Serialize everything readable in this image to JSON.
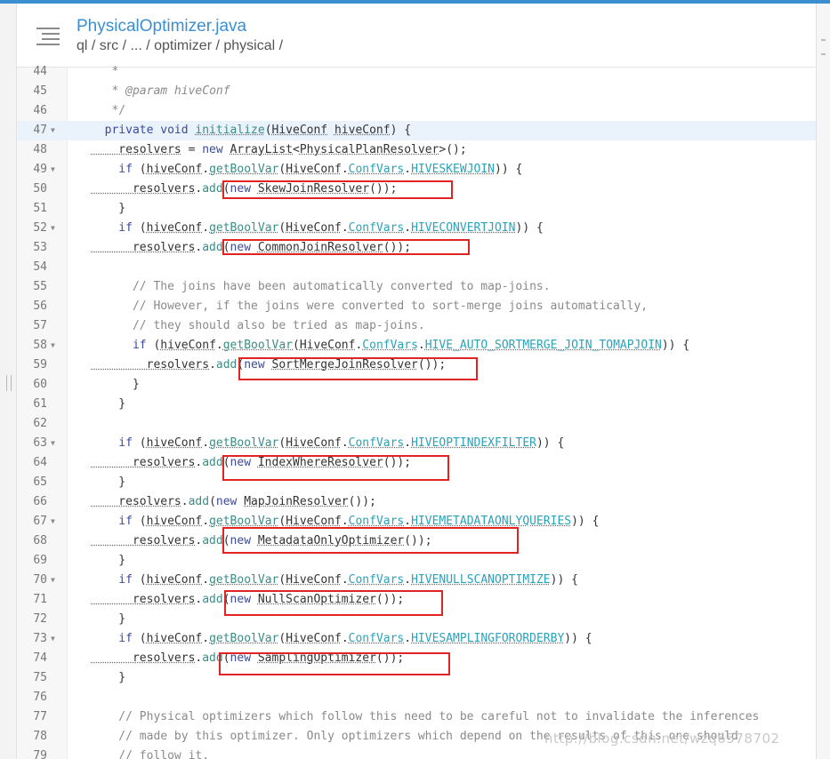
{
  "header": {
    "file_title": "PhysicalOptimizer.java",
    "breadcrumb": "ql / src / ... / optimizer / physical /"
  },
  "icons": {
    "menu": "hamburger-menu-icon",
    "fold": "fold-arrow-icon"
  },
  "colors": {
    "accent": "#3b8fd1",
    "highlight_box": "#e02424",
    "active_line": "#eaf2fb"
  },
  "editor": {
    "active_line": 47,
    "lines": [
      {
        "n": "44",
        "fold": false,
        "parts": [
          [
            "c",
            "   *"
          ]
        ]
      },
      {
        "n": "45",
        "fold": false,
        "parts": [
          [
            "c",
            "   * "
          ],
          [
            "ci",
            "@param"
          ],
          [
            "ci",
            " hiveConf"
          ]
        ]
      },
      {
        "n": "46",
        "fold": false,
        "parts": [
          [
            "c",
            "   */"
          ]
        ]
      },
      {
        "n": "47",
        "fold": true,
        "parts": [
          [
            "k",
            "  private void "
          ],
          [
            "mu",
            "initialize"
          ],
          [
            "t",
            "("
          ],
          [
            "tu",
            "HiveConf"
          ],
          [
            "t",
            " "
          ],
          [
            "tu",
            "hiveConf"
          ],
          [
            "t",
            ") {"
          ]
        ]
      },
      {
        "n": "48",
        "fold": false,
        "parts": [
          [
            "tu",
            "    resolvers"
          ],
          [
            "t",
            " = "
          ],
          [
            "k",
            "new "
          ],
          [
            "tu",
            "ArrayList"
          ],
          [
            "t",
            "<"
          ],
          [
            "tu",
            "PhysicalPlanResolver"
          ],
          [
            "t",
            ">();"
          ]
        ]
      },
      {
        "n": "49",
        "fold": true,
        "parts": [
          [
            "k",
            "    if "
          ],
          [
            "t",
            "("
          ],
          [
            "tu",
            "hiveConf"
          ],
          [
            "t",
            "."
          ],
          [
            "mu",
            "getBoolVar"
          ],
          [
            "t",
            "("
          ],
          [
            "tu",
            "HiveConf"
          ],
          [
            "t",
            "."
          ],
          [
            "su",
            "ConfVars"
          ],
          [
            "t",
            "."
          ],
          [
            "su",
            "HIVESKEWJOIN"
          ],
          [
            "t",
            ")) {"
          ]
        ]
      },
      {
        "n": "50",
        "fold": false,
        "parts": [
          [
            "tu",
            "      resolvers"
          ],
          [
            "t",
            "."
          ],
          [
            "m",
            "add"
          ],
          [
            "t",
            "("
          ],
          [
            "k",
            "new "
          ],
          [
            "tu",
            "SkewJoinResolver"
          ],
          [
            "t",
            "());"
          ]
        ]
      },
      {
        "n": "51",
        "fold": false,
        "parts": [
          [
            "t",
            "    }"
          ]
        ]
      },
      {
        "n": "52",
        "fold": true,
        "parts": [
          [
            "k",
            "    if "
          ],
          [
            "t",
            "("
          ],
          [
            "tu",
            "hiveConf"
          ],
          [
            "t",
            "."
          ],
          [
            "mu",
            "getBoolVar"
          ],
          [
            "t",
            "("
          ],
          [
            "tu",
            "HiveConf"
          ],
          [
            "t",
            "."
          ],
          [
            "su",
            "ConfVars"
          ],
          [
            "t",
            "."
          ],
          [
            "su",
            "HIVECONVERTJOIN"
          ],
          [
            "t",
            ")) {"
          ]
        ]
      },
      {
        "n": "53",
        "fold": false,
        "parts": [
          [
            "tu",
            "      resolvers"
          ],
          [
            "t",
            "."
          ],
          [
            "m",
            "add"
          ],
          [
            "t",
            "("
          ],
          [
            "k",
            "new "
          ],
          [
            "tu",
            "CommonJoinResolver"
          ],
          [
            "t",
            "());"
          ]
        ]
      },
      {
        "n": "54",
        "fold": false,
        "parts": [
          [
            "t",
            ""
          ]
        ]
      },
      {
        "n": "55",
        "fold": false,
        "parts": [
          [
            "c",
            "      // The joins have been automatically converted to map-joins."
          ]
        ]
      },
      {
        "n": "56",
        "fold": false,
        "parts": [
          [
            "c",
            "      // However, if the joins were converted to sort-merge joins automatically,"
          ]
        ]
      },
      {
        "n": "57",
        "fold": false,
        "parts": [
          [
            "c",
            "      // they should also be tried as map-joins."
          ]
        ]
      },
      {
        "n": "58",
        "fold": true,
        "parts": [
          [
            "k",
            "      if "
          ],
          [
            "t",
            "("
          ],
          [
            "tu",
            "hiveConf"
          ],
          [
            "t",
            "."
          ],
          [
            "mu",
            "getBoolVar"
          ],
          [
            "t",
            "("
          ],
          [
            "tu",
            "HiveConf"
          ],
          [
            "t",
            "."
          ],
          [
            "su",
            "ConfVars"
          ],
          [
            "t",
            "."
          ],
          [
            "su",
            "HIVE_AUTO_SORTMERGE_JOIN_TOMAPJOIN"
          ],
          [
            "t",
            ")) {"
          ]
        ]
      },
      {
        "n": "59",
        "fold": false,
        "parts": [
          [
            "tu",
            "        resolvers"
          ],
          [
            "t",
            "."
          ],
          [
            "m",
            "add"
          ],
          [
            "t",
            "("
          ],
          [
            "k",
            "new "
          ],
          [
            "tu",
            "SortMergeJoinResolver"
          ],
          [
            "t",
            "());"
          ]
        ]
      },
      {
        "n": "60",
        "fold": false,
        "parts": [
          [
            "t",
            "      }"
          ]
        ]
      },
      {
        "n": "61",
        "fold": false,
        "parts": [
          [
            "t",
            "    }"
          ]
        ]
      },
      {
        "n": "62",
        "fold": false,
        "parts": [
          [
            "t",
            ""
          ]
        ]
      },
      {
        "n": "63",
        "fold": true,
        "parts": [
          [
            "k",
            "    if "
          ],
          [
            "t",
            "("
          ],
          [
            "tu",
            "hiveConf"
          ],
          [
            "t",
            "."
          ],
          [
            "mu",
            "getBoolVar"
          ],
          [
            "t",
            "("
          ],
          [
            "tu",
            "HiveConf"
          ],
          [
            "t",
            "."
          ],
          [
            "su",
            "ConfVars"
          ],
          [
            "t",
            "."
          ],
          [
            "su",
            "HIVEOPTINDEXFILTER"
          ],
          [
            "t",
            ")) {"
          ]
        ]
      },
      {
        "n": "64",
        "fold": false,
        "parts": [
          [
            "tu",
            "      resolvers"
          ],
          [
            "t",
            "."
          ],
          [
            "m",
            "add"
          ],
          [
            "t",
            "("
          ],
          [
            "k",
            "new "
          ],
          [
            "tu",
            "IndexWhereResolver"
          ],
          [
            "t",
            "());"
          ]
        ]
      },
      {
        "n": "65",
        "fold": false,
        "parts": [
          [
            "t",
            "    }"
          ]
        ]
      },
      {
        "n": "66",
        "fold": false,
        "parts": [
          [
            "tu",
            "    resolvers"
          ],
          [
            "t",
            "."
          ],
          [
            "m",
            "add"
          ],
          [
            "t",
            "("
          ],
          [
            "k",
            "new "
          ],
          [
            "tu",
            "MapJoinResolver"
          ],
          [
            "t",
            "());"
          ]
        ]
      },
      {
        "n": "67",
        "fold": true,
        "parts": [
          [
            "k",
            "    if "
          ],
          [
            "t",
            "("
          ],
          [
            "tu",
            "hiveConf"
          ],
          [
            "t",
            "."
          ],
          [
            "mu",
            "getBoolVar"
          ],
          [
            "t",
            "("
          ],
          [
            "tu",
            "HiveConf"
          ],
          [
            "t",
            "."
          ],
          [
            "su",
            "ConfVars"
          ],
          [
            "t",
            "."
          ],
          [
            "su",
            "HIVEMETADATAONLYQUERIES"
          ],
          [
            "t",
            ")) {"
          ]
        ]
      },
      {
        "n": "68",
        "fold": false,
        "parts": [
          [
            "tu",
            "      resolvers"
          ],
          [
            "t",
            "."
          ],
          [
            "m",
            "add"
          ],
          [
            "t",
            "("
          ],
          [
            "k",
            "new "
          ],
          [
            "tu",
            "MetadataOnlyOptimizer"
          ],
          [
            "t",
            "());"
          ]
        ]
      },
      {
        "n": "69",
        "fold": false,
        "parts": [
          [
            "t",
            "    }"
          ]
        ]
      },
      {
        "n": "70",
        "fold": true,
        "parts": [
          [
            "k",
            "    if "
          ],
          [
            "t",
            "("
          ],
          [
            "tu",
            "hiveConf"
          ],
          [
            "t",
            "."
          ],
          [
            "mu",
            "getBoolVar"
          ],
          [
            "t",
            "("
          ],
          [
            "tu",
            "HiveConf"
          ],
          [
            "t",
            "."
          ],
          [
            "su",
            "ConfVars"
          ],
          [
            "t",
            "."
          ],
          [
            "su",
            "HIVENULLSCANOPTIMIZE"
          ],
          [
            "t",
            ")) {"
          ]
        ]
      },
      {
        "n": "71",
        "fold": false,
        "parts": [
          [
            "tu",
            "      resolvers"
          ],
          [
            "t",
            "."
          ],
          [
            "m",
            "add"
          ],
          [
            "t",
            "("
          ],
          [
            "k",
            "new "
          ],
          [
            "tu",
            "NullScanOptimizer"
          ],
          [
            "t",
            "());"
          ]
        ]
      },
      {
        "n": "72",
        "fold": false,
        "parts": [
          [
            "t",
            "    }"
          ]
        ]
      },
      {
        "n": "73",
        "fold": true,
        "parts": [
          [
            "k",
            "    if "
          ],
          [
            "t",
            "("
          ],
          [
            "tu",
            "hiveConf"
          ],
          [
            "t",
            "."
          ],
          [
            "mu",
            "getBoolVar"
          ],
          [
            "t",
            "("
          ],
          [
            "tu",
            "HiveConf"
          ],
          [
            "t",
            "."
          ],
          [
            "su",
            "ConfVars"
          ],
          [
            "t",
            "."
          ],
          [
            "su",
            "HIVESAMPLINGFORORDERBY"
          ],
          [
            "t",
            ")) {"
          ]
        ]
      },
      {
        "n": "74",
        "fold": false,
        "parts": [
          [
            "tu",
            "      resolvers"
          ],
          [
            "t",
            "."
          ],
          [
            "m",
            "add"
          ],
          [
            "t",
            "("
          ],
          [
            "k",
            "new "
          ],
          [
            "tu",
            "SamplingOptimizer"
          ],
          [
            "t",
            "());"
          ]
        ]
      },
      {
        "n": "75",
        "fold": false,
        "parts": [
          [
            "t",
            "    }"
          ]
        ]
      },
      {
        "n": "76",
        "fold": false,
        "parts": [
          [
            "t",
            ""
          ]
        ]
      },
      {
        "n": "77",
        "fold": false,
        "parts": [
          [
            "c",
            "    // Physical optimizers which follow this need to be careful not to invalidate the inferences"
          ]
        ]
      },
      {
        "n": "78",
        "fold": false,
        "parts": [
          [
            "c",
            "    // made by this optimizer. Only optimizers which depend on the results of this one should"
          ]
        ]
      },
      {
        "n": "79",
        "fold": false,
        "parts": [
          [
            "c",
            "    // follow it."
          ]
        ]
      }
    ]
  },
  "watermark": "http://blog.csdn.net/wzq6578702"
}
